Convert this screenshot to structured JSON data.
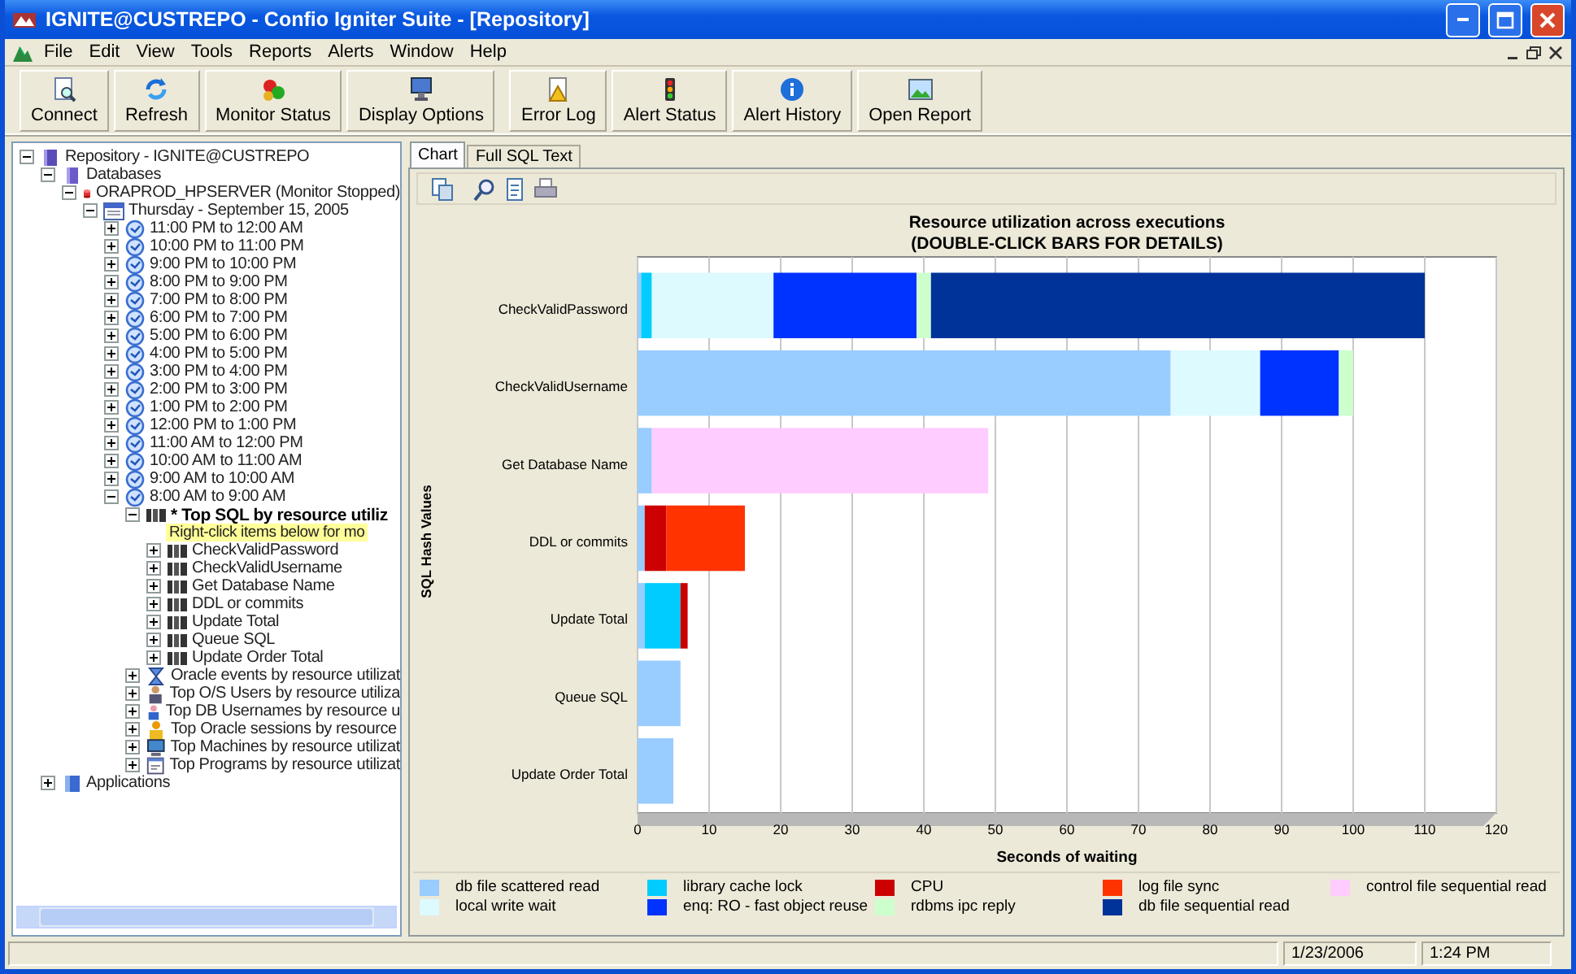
{
  "window": {
    "title": "IGNITE@CUSTREPO - Confio Igniter Suite - [Repository]"
  },
  "menu": [
    {
      "label": "File"
    },
    {
      "label": "Edit"
    },
    {
      "label": "View"
    },
    {
      "label": "Tools"
    },
    {
      "label": "Reports"
    },
    {
      "label": "Alerts"
    },
    {
      "label": "Window"
    },
    {
      "label": "Help"
    }
  ],
  "toolbar": [
    {
      "label": "Connect",
      "kind": "connect"
    },
    {
      "label": "Refresh",
      "kind": "refresh"
    },
    {
      "label": "Monitor Status",
      "kind": "monitor-status"
    },
    {
      "label": "Display Options",
      "kind": "display-options"
    },
    {
      "label": "Error Log",
      "kind": "error-log"
    },
    {
      "label": "Alert Status",
      "kind": "alert-status"
    },
    {
      "label": "Alert History",
      "kind": "alert-history"
    },
    {
      "label": "Open Report",
      "kind": "open-report"
    }
  ],
  "tree": [
    {
      "label": "Repository - IGNITE@CUSTREPO",
      "kind": "repository",
      "expanded": true,
      "children": [
        {
          "label": "Databases",
          "kind": "database",
          "expanded": true,
          "children": [
            {
              "label": "ORAPROD_HPSERVER (Monitor Stopped)",
              "kind": "server",
              "expanded": true,
              "children": [
                {
                  "label": "Thursday - September 15, 2005",
                  "kind": "calendar",
                  "expanded": true,
                  "children": [
                    {
                      "label": "11:00 PM to 12:00 AM",
                      "kind": "clock",
                      "expanded": false
                    },
                    {
                      "label": "10:00 PM to 11:00 PM",
                      "kind": "clock",
                      "expanded": false
                    },
                    {
                      "label": "9:00 PM to 10:00 PM",
                      "kind": "clock",
                      "expanded": false
                    },
                    {
                      "label": "8:00 PM to 9:00 PM",
                      "kind": "clock",
                      "expanded": false
                    },
                    {
                      "label": "7:00 PM to 8:00 PM",
                      "kind": "clock",
                      "expanded": false
                    },
                    {
                      "label": "6:00 PM to 7:00 PM",
                      "kind": "clock",
                      "expanded": false
                    },
                    {
                      "label": "5:00 PM to 6:00 PM",
                      "kind": "clock",
                      "expanded": false
                    },
                    {
                      "label": "4:00 PM to 5:00 PM",
                      "kind": "clock",
                      "expanded": false
                    },
                    {
                      "label": "3:00 PM to 4:00 PM",
                      "kind": "clock",
                      "expanded": false
                    },
                    {
                      "label": "2:00 PM to 3:00 PM",
                      "kind": "clock",
                      "expanded": false
                    },
                    {
                      "label": "1:00 PM to 2:00 PM",
                      "kind": "clock",
                      "expanded": false
                    },
                    {
                      "label": "12:00 PM to 1:00 PM",
                      "kind": "clock",
                      "expanded": false
                    },
                    {
                      "label": "11:00 AM to 12:00 PM",
                      "kind": "clock",
                      "expanded": false
                    },
                    {
                      "label": "10:00 AM to 11:00 AM",
                      "kind": "clock",
                      "expanded": false
                    },
                    {
                      "label": "9:00 AM to 10:00 AM",
                      "kind": "clock",
                      "expanded": false
                    },
                    {
                      "label": "8:00 AM to 9:00 AM",
                      "kind": "clock",
                      "expanded": true,
                      "children": [
                        {
                          "label": "* Top SQL by resource utiliz",
                          "kind": "sql-group",
                          "expanded": true,
                          "children": [
                            {
                              "label": "Right-click items below for mo",
                              "kind": "hint"
                            },
                            {
                              "label": "CheckValidPassword",
                              "kind": "sql",
                              "expanded": false
                            },
                            {
                              "label": "CheckValidUsername",
                              "kind": "sql",
                              "expanded": false
                            },
                            {
                              "label": "Get Database Name",
                              "kind": "sql",
                              "expanded": false
                            },
                            {
                              "label": "DDL or commits",
                              "kind": "sql",
                              "expanded": false
                            },
                            {
                              "label": "Update Total",
                              "kind": "sql",
                              "expanded": false
                            },
                            {
                              "label": "Queue SQL",
                              "kind": "sql",
                              "expanded": false
                            },
                            {
                              "label": "Update Order Total",
                              "kind": "sql",
                              "expanded": false
                            }
                          ]
                        },
                        {
                          "label": "Oracle events by resource utilizat",
                          "kind": "events",
                          "expanded": false
                        },
                        {
                          "label": "Top O/S Users by resource utiliza",
                          "kind": "user",
                          "expanded": false
                        },
                        {
                          "label": "Top DB Usernames by resource u",
                          "kind": "dbuser",
                          "expanded": false
                        },
                        {
                          "label": "Top Oracle sessions by resource",
                          "kind": "session",
                          "expanded": false
                        },
                        {
                          "label": "Top Machines by resource utilizat",
                          "kind": "machine",
                          "expanded": false
                        },
                        {
                          "label": "Top Programs by resource utilizat",
                          "kind": "program",
                          "expanded": false
                        }
                      ]
                    }
                  ]
                }
              ]
            }
          ]
        },
        {
          "label": "Applications",
          "kind": "applications",
          "expanded": false
        }
      ]
    }
  ],
  "tabs": [
    {
      "label": "Chart",
      "selected": true
    },
    {
      "label": "Full SQL Text",
      "selected": false
    }
  ],
  "chart_data": {
    "type": "bar",
    "orientation": "horizontal",
    "stacked": true,
    "title": "Resource utilization across executions\n(DOUBLE-CLICK BARS FOR DETAILS)",
    "xlabel": "Seconds of waiting",
    "ylabel": "SQL Hash Values",
    "categories": [
      "CheckValidPassword",
      "CheckValidUsername",
      "Get Database Name",
      "DDL or commits",
      "Update Total",
      "Queue SQL",
      "Update Order Total"
    ],
    "series": [
      {
        "name": "db file scattered read",
        "color": "#99ccff",
        "values": [
          0.5,
          74.5,
          2,
          1,
          1,
          6,
          5
        ]
      },
      {
        "name": "library cache lock",
        "color": "#00ccff",
        "values": [
          1.5,
          0,
          0,
          0,
          5,
          0,
          0
        ]
      },
      {
        "name": "CPU",
        "color": "#cc0000",
        "values": [
          0,
          0,
          0,
          3,
          1,
          0,
          0
        ]
      },
      {
        "name": "log file sync",
        "color": "#ff3300",
        "values": [
          0,
          0,
          0,
          11,
          0,
          0,
          0
        ]
      },
      {
        "name": "control file sequential read",
        "color": "#ffccff",
        "values": [
          0,
          0,
          47,
          0,
          0,
          0,
          0
        ]
      },
      {
        "name": "local write wait",
        "color": "#ddfaff",
        "values": [
          17,
          12.5,
          0,
          0,
          0,
          0,
          0
        ]
      },
      {
        "name": "enq: RO - fast object reuse",
        "color": "#0033ff",
        "values": [
          20,
          11,
          0,
          0,
          0,
          0,
          0
        ]
      },
      {
        "name": "rdbms ipc reply",
        "color": "#ccffcc",
        "values": [
          2,
          2,
          0,
          0,
          0,
          0,
          0
        ]
      },
      {
        "name": "db file sequential read",
        "color": "#003399",
        "values": [
          69,
          0,
          0,
          0,
          0,
          0,
          0
        ]
      }
    ],
    "xlim": [
      0,
      120
    ],
    "grid": true,
    "xticks": [
      0,
      10,
      20,
      30,
      40,
      50,
      60,
      70,
      80,
      90,
      100,
      110,
      120
    ]
  },
  "status_bar": {
    "date": "1/23/2006",
    "time": "1:24 PM"
  }
}
